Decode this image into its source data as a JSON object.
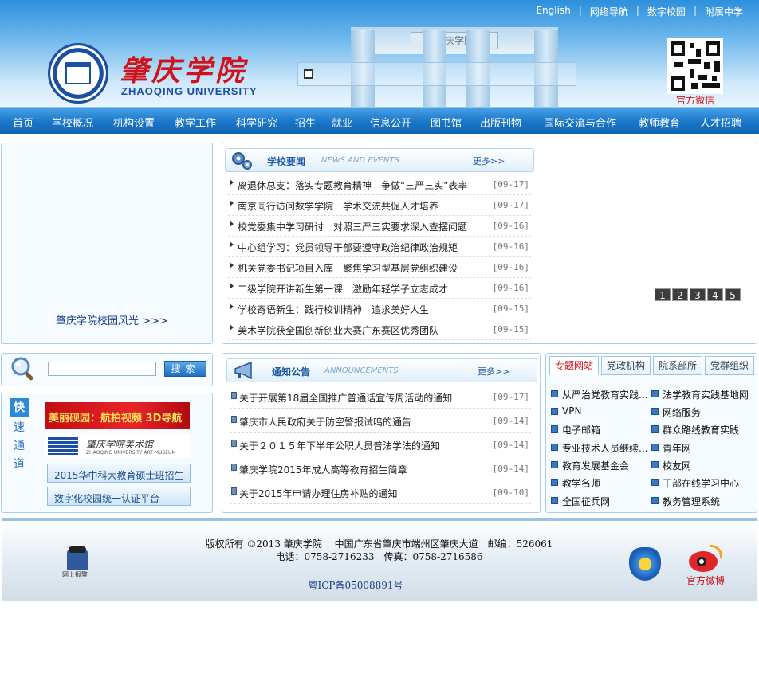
{
  "top_links": [
    "English",
    "网络导航",
    "数字校园",
    "附属中学"
  ],
  "logo": {
    "title": "肇庆学院",
    "subtitle": "ZHAOQING UNIVERSITY"
  },
  "gate_plaque": "肇庆学院",
  "wechat_label": "官方微信",
  "nav": [
    "首页",
    "学校概况",
    "机构设置",
    "教学工作",
    "科学研究",
    "招生",
    "就业",
    "信息公开",
    "图书馆",
    "出版刊物",
    "国际交流与合作",
    "教师教育",
    "人才招聘"
  ],
  "campus": {
    "label": "肇庆学院校园风光 >>>"
  },
  "news": {
    "title": "学校要闻",
    "title_en": "NEWS AND EVENTS",
    "more": "更多>>",
    "items": [
      {
        "title": "离退休总支：落实专题教育精神　争做“三严三实”表率",
        "date": "[09-17]"
      },
      {
        "title": "南京同行访问数学学院　学术交流共促人才培养",
        "date": "[09-17]"
      },
      {
        "title": "校党委集中学习研讨　对照三严三实要求深入查摆问题",
        "date": "[09-16]"
      },
      {
        "title": "中心组学习：党员领导干部要遵守政治纪律政治规矩",
        "date": "[09-16]"
      },
      {
        "title": "机关党委书记项目入库　聚焦学习型基层党组织建设",
        "date": "[09-16]"
      },
      {
        "title": "二级学院开讲新生第一课　激励年轻学子立志成才",
        "date": "[09-16]"
      },
      {
        "title": "学校寄语新生：践行校训精神　追求美好人生",
        "date": "[09-15]"
      },
      {
        "title": "美术学院获全国创新创业大赛广东赛区优秀团队",
        "date": "[09-15]"
      }
    ]
  },
  "pager": [
    "1",
    "2",
    "3",
    "4",
    "5"
  ],
  "search": {
    "button": "搜索",
    "placeholder": ""
  },
  "notice": {
    "title": "通知公告",
    "title_en": "ANNOUNCEMENTS",
    "more": "更多>>",
    "items": [
      {
        "title": "关于开展第18届全国推广普通话宣传周活动的通知",
        "date": "[09-17]"
      },
      {
        "title": "肇庆市人民政府关于防空警报试鸣的通告",
        "date": "[09-14]"
      },
      {
        "title": "关于２０１５年下半年公职人员普法学法的通知",
        "date": "[09-14]"
      },
      {
        "title": "肇庆学院2015年成人高等教育招生简章",
        "date": "[09-14]"
      },
      {
        "title": "关于2015年申请办理住房补贴的通知",
        "date": "[09-10]"
      }
    ]
  },
  "quick": {
    "first": "快",
    "rest": [
      "速",
      "通",
      "道"
    ],
    "banner1": "美丽砚园：航拍视频 3D导航",
    "banner2_title": "肇庆学院美术馆",
    "banner2_sub": "ZHAOQING UNIVERSITY ART MUSEUM",
    "buttons": [
      "2015华中科大教育硕士班招生",
      "数字化校园统一认证平台"
    ]
  },
  "tabs": [
    "专题网站",
    "党政机构",
    "院系部所",
    "党群组织"
  ],
  "links": {
    "left": [
      "从严治党教育实践...",
      "VPN",
      "电子邮箱",
      "专业技术人员继续...",
      "教育发展基金会",
      "教学名师",
      "全国征兵网"
    ],
    "right": [
      "法学教育实践基地网",
      "网络服务",
      "群众路线教育实践",
      "青年网",
      "校友网",
      "干部在线学习中心",
      "教务管理系统"
    ]
  },
  "footer": {
    "line1": "版权所有 ©2013 肇庆学院　 中国广东省肇庆市端州区肇庆大道　邮编：526061",
    "line2": "电话：0758-2716233　传真：0758-2716586",
    "icp": "粤ICP备05008891号",
    "police_label": "网上报警",
    "weibo_label": "官方微博"
  },
  "colors": {
    "nav": "#1977c9",
    "brand_red": "#d0121b",
    "link_blue": "#1d5aa6"
  }
}
